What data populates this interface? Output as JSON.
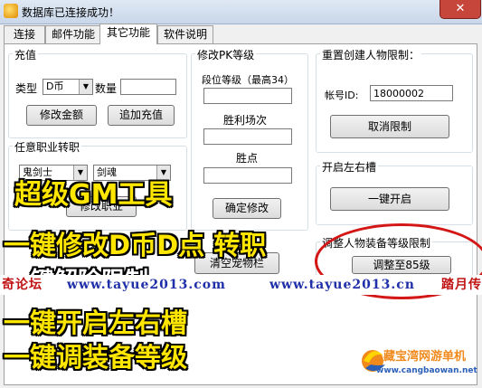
{
  "window": {
    "title": "数据库已连接成功！",
    "close": "✕"
  },
  "tabs": [
    {
      "label": "连接"
    },
    {
      "label": "邮件功能"
    },
    {
      "label": "其它功能"
    },
    {
      "label": "软件说明"
    }
  ],
  "recharge": {
    "title": "充值",
    "type_label": "类型",
    "type_value": "D币",
    "amount_label": "数量",
    "amount_value": "",
    "modify_button": "修改金额",
    "add_button": "追加充值"
  },
  "job_change": {
    "title": "任意职业转职",
    "select1": "鬼剑士",
    "select2": "剑魂",
    "button": "修改职业"
  },
  "pk": {
    "title": "修改PK等级",
    "rank_label": "段位等级（最高34）",
    "wins_label": "胜利场次",
    "points_label": "胜点",
    "confirm_button": "确定修改"
  },
  "reset": {
    "title": "重置创建人物限制：",
    "account_label": "帐号ID:",
    "account_value": "18000002",
    "cancel_button": "取消限制"
  },
  "slots": {
    "title": "开启左右槽",
    "button": "一键开启"
  },
  "equip": {
    "title": "调整人物装备等级限制",
    "button": "调整至85级"
  },
  "pet": {
    "button": "清空宠物栏"
  },
  "overlay": {
    "line1": "超级GM工具",
    "line2": "一键修改D币D点 转职",
    "line3": "一键解除限制",
    "line4": "一键开启左右槽",
    "line5": "一键调装备等级"
  },
  "banner": {
    "left": "奇论坛",
    "mid": "www.tayue2013.com",
    "right": "www.tayue2013.cn",
    "end": "踏月传"
  },
  "logo": {
    "name": "藏宝湾网游单机",
    "url": "www.cangbaowan.net"
  },
  "colors": {
    "overlay_yellow": "#ffe600",
    "ring_red": "#d31616",
    "banner_blue": "#1f2fa8",
    "banner_red": "#c01414"
  }
}
